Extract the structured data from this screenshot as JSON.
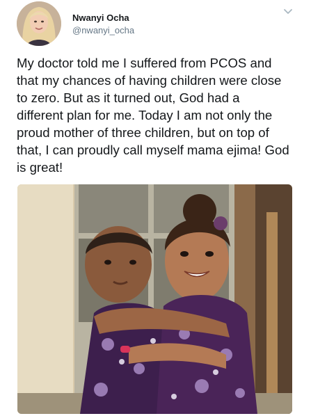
{
  "tweet": {
    "author": {
      "display_name": "Nwanyi Ocha",
      "handle": "@nwanyi_ocha"
    },
    "text": "My doctor told me I suffered from PCOS and\nthat my chances of having children were close\nto zero. But as it turned out, God had a\ndifferent plan for me. Today I am not only the\nproud mother of three children, but on top of\nthat, I can proudly call myself mama ejima! God\nis great!",
    "menu_icon": "chevron-down-icon",
    "media": {
      "type": "photo",
      "alt": "Two toddlers hugging in matching purple floral dresses"
    }
  },
  "colors": {
    "text_primary": "#14171a",
    "text_secondary": "#657786",
    "chevron": "#aab8c2",
    "dress_purple": "#3d1f4d"
  }
}
